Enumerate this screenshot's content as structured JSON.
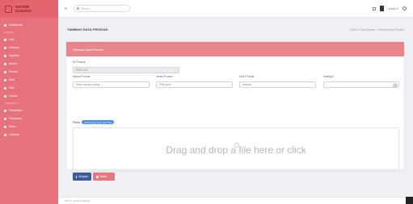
{
  "brand": {
    "line1": "SISTEM",
    "line2": "GUDANG"
  },
  "sidebar": {
    "items": [
      {
        "label": "Dashboard"
      },
      {
        "section": "MASTER"
      },
      {
        "label": "Unit"
      },
      {
        "label": "Kategori"
      },
      {
        "label": "Supplier"
      },
      {
        "label": "Merek"
      },
      {
        "label": "Produk"
      },
      {
        "label": "Stok"
      },
      {
        "label": "Rak"
      },
      {
        "label": "Lokasi"
      },
      {
        "section": "TRANSAKSI"
      },
      {
        "label": "Pembelian"
      },
      {
        "label": "Penjualan"
      },
      {
        "label": "Retur"
      },
      {
        "label": "Laporan"
      }
    ]
  },
  "topbar": {
    "menu_glyph": "≡",
    "search_placeholder": "Search...",
    "user_label": "Admin ▾"
  },
  "page": {
    "title": "TAMBAH DATA PRODUK",
    "breadcrumb": "Home / Data Master / Tambah Data Produk"
  },
  "card": {
    "header": "Tambah Data Produk",
    "fields": {
      "id_label": "ID Produk",
      "id_value": "PRD-015",
      "name_label": "Nama Produk",
      "name_placeholder": "Ketik nama produk",
      "type_label": "Jenis Produk",
      "type_placeholder": "Pilih jenis",
      "unit_label": "Unit Produk",
      "unit_placeholder": "Satuan",
      "stock_label": "Kategori",
      "stock_value": "-"
    },
    "photo_label": "Photo",
    "photo_badge": "Format jpg, png max 2mb",
    "dropzone_text": "Drag and drop a file here or click",
    "save_label": "Simpan",
    "cancel_label": "Batal"
  },
  "footer": {
    "text": "2024 © Sistem Gudang"
  }
}
